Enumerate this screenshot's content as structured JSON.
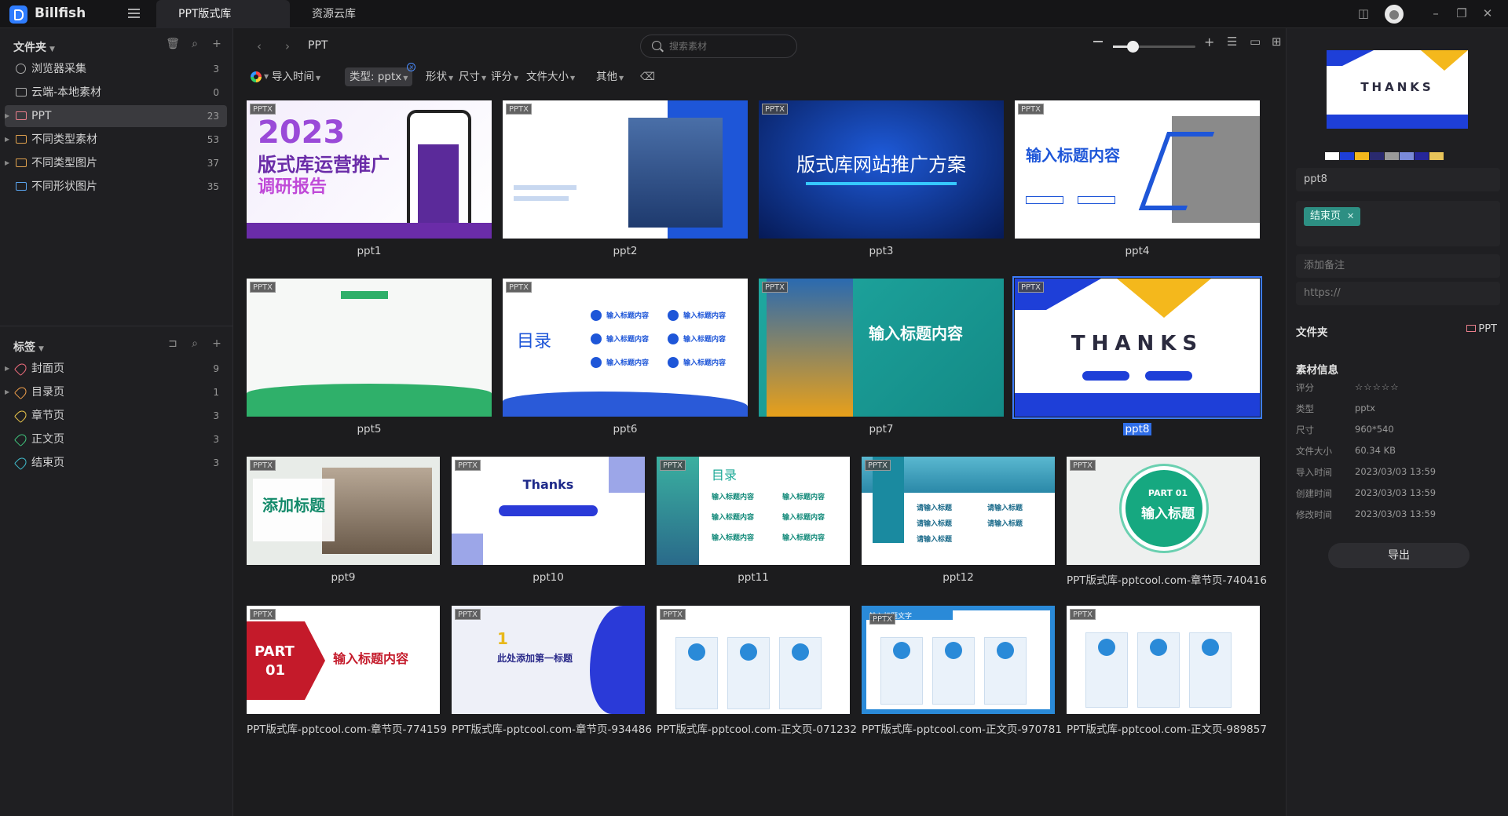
{
  "app": {
    "name": "Billfish"
  },
  "tabs": [
    {
      "label": "PPT版式库",
      "active": true
    },
    {
      "label": "资源云库",
      "active": false
    }
  ],
  "sidebar": {
    "folders_header": "文件夹",
    "folders": [
      {
        "label": "浏览器采集",
        "count": "3"
      },
      {
        "label": "云端-本地素材",
        "count": "0"
      },
      {
        "label": "PPT",
        "count": "23"
      },
      {
        "label": "不同类型素材",
        "count": "53"
      },
      {
        "label": "不同类型图片",
        "count": "37"
      },
      {
        "label": "不同形状图片",
        "count": "35"
      }
    ],
    "tags_header": "标签",
    "tags": [
      {
        "label": "封面页",
        "count": "9",
        "color": "#ea6b7a"
      },
      {
        "label": "目录页",
        "count": "1",
        "color": "#e89a4a"
      },
      {
        "label": "章节页",
        "count": "3",
        "color": "#e8c44a"
      },
      {
        "label": "正文页",
        "count": "3",
        "color": "#3fbf7a"
      },
      {
        "label": "结束页",
        "count": "3",
        "color": "#3fb8c8"
      }
    ]
  },
  "toolbar": {
    "breadcrumb": "PPT",
    "search_placeholder": "搜索素材"
  },
  "filters": {
    "import_time": "导入时间",
    "type_prefix": "类型:",
    "type_value": "pptx",
    "shape": "形状",
    "size": "尺寸",
    "rating": "评分",
    "file_size": "文件大小",
    "other": "其他"
  },
  "grid": {
    "badge": "PPTX",
    "items": [
      {
        "name": "ppt1",
        "selected": false
      },
      {
        "name": "ppt2",
        "selected": false
      },
      {
        "name": "ppt3",
        "selected": false
      },
      {
        "name": "ppt4",
        "selected": false
      },
      {
        "name": "ppt5",
        "selected": false
      },
      {
        "name": "ppt6",
        "selected": false
      },
      {
        "name": "ppt7",
        "selected": false
      },
      {
        "name": "ppt8",
        "selected": true
      },
      {
        "name": "ppt9",
        "selected": false
      },
      {
        "name": "ppt10",
        "selected": false
      },
      {
        "name": "ppt11",
        "selected": false
      },
      {
        "name": "ppt12",
        "selected": false
      },
      {
        "name": "PPT版式库-pptcool.com-章节页-740416",
        "selected": false
      },
      {
        "name": "PPT版式库-pptcool.com-章节页-774159",
        "selected": false
      },
      {
        "name": "PPT版式库-pptcool.com-章节页-934486",
        "selected": false
      },
      {
        "name": "PPT版式库-pptcool.com-正文页-071232",
        "selected": false
      },
      {
        "name": "PPT版式库-pptcool.com-正文页-970781",
        "selected": false
      },
      {
        "name": "PPT版式库-pptcool.com-正文页-989857",
        "selected": false
      }
    ],
    "thumb_text": {
      "ppt1_title": "2023",
      "ppt1_sub": "版式库运营推广",
      "ppt1_sub2": "调研报告",
      "ppt3_title": "版式库网站推广方案",
      "ppt4_title": "输入标题内容",
      "ppt6_title": "目录",
      "ppt6_item": "输入标题内容",
      "ppt7_title": "输入标题内容",
      "ppt8_title": "THANKS",
      "ppt9_title": "添加标题",
      "ppt10_title": "Thanks",
      "ppt11_title": "目录",
      "ppt11_item": "输入标题内容",
      "ppt12_item": "请输入标题",
      "c13_part": "PART 01",
      "c13_title": "输入标题",
      "c14_part": "PART",
      "c14_num": "01",
      "c14_title": "输入标题内容",
      "c15_num": "1",
      "c15_title": "此处添加第一标题",
      "c17_title": "输入标题文字"
    }
  },
  "inspector": {
    "preview_text": "THANKS",
    "palette": [
      "#ffffff",
      "#1e3fd8",
      "#f4b81c",
      "#2a2a6e",
      "#9a9a9a",
      "#7a8ad8",
      "#26269a",
      "#e8c45a"
    ],
    "name_value": "ppt8",
    "tag_chip": "结束页",
    "note_placeholder": "添加备注",
    "url_placeholder": "https://",
    "folder_label": "文件夹",
    "folder_value": "PPT",
    "info_header": "素材信息",
    "info": [
      {
        "k": "评分",
        "v": "☆☆☆☆☆"
      },
      {
        "k": "类型",
        "v": "pptx"
      },
      {
        "k": "尺寸",
        "v": "960*540"
      },
      {
        "k": "文件大小",
        "v": "60.34 KB"
      },
      {
        "k": "导入时间",
        "v": "2023/03/03 13:59"
      },
      {
        "k": "创建时间",
        "v": "2023/03/03 13:59"
      },
      {
        "k": "修改时间",
        "v": "2023/03/03 13:59"
      }
    ],
    "export_label": "导出"
  }
}
